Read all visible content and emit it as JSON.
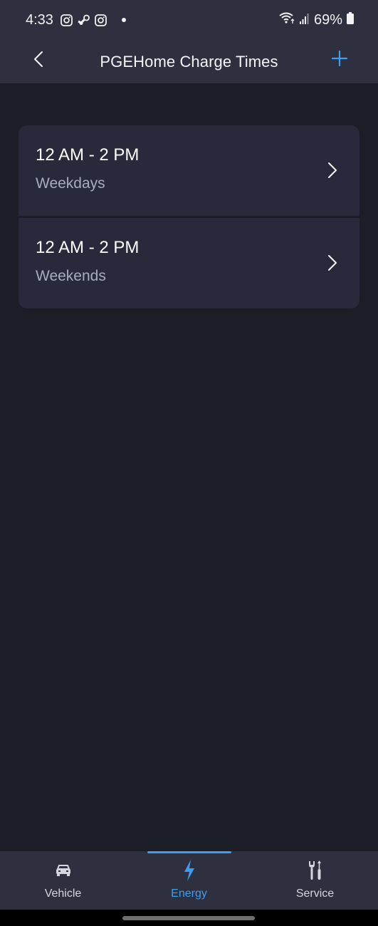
{
  "status_bar": {
    "time": "4:33",
    "notification_icons": [
      "instagram-icon",
      "steam-icon",
      "instagram-icon",
      "dot"
    ],
    "battery_percent": "69%",
    "system_icons": [
      "wifi-icon",
      "signal-icon",
      "battery-icon"
    ]
  },
  "header": {
    "title": "PGEHome Charge Times",
    "back_icon": "chevron-left-icon",
    "add_icon": "plus-icon",
    "accent_color": "#3b9ef0"
  },
  "schedules": [
    {
      "time_range": "12 AM - 2 PM",
      "days": "Weekdays"
    },
    {
      "time_range": "12 AM - 2 PM",
      "days": "Weekends"
    }
  ],
  "tab_bar": {
    "active": "Energy",
    "tabs": [
      {
        "label": "Vehicle",
        "icon": "car-icon"
      },
      {
        "label": "Energy",
        "icon": "lightning-icon"
      },
      {
        "label": "Service",
        "icon": "tools-icon"
      }
    ]
  }
}
